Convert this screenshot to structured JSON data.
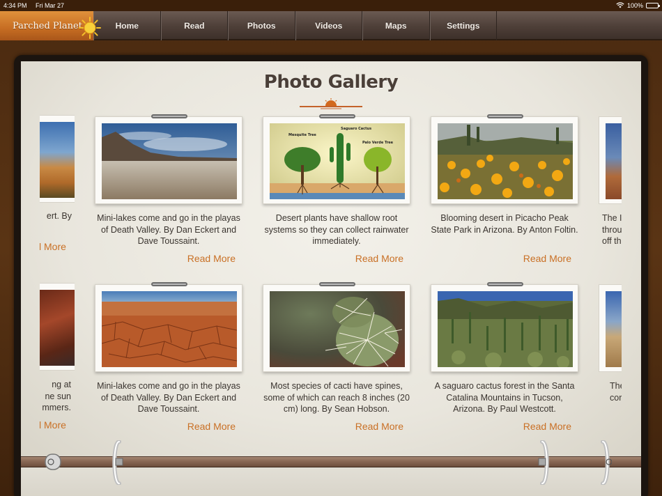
{
  "status": {
    "time": "4:34 PM",
    "date": "Fri Mar 27",
    "battery": "100%"
  },
  "nav": {
    "brand": "Parched Planet",
    "tabs": [
      "Home",
      "Read",
      "Photos",
      "Videos",
      "Maps",
      "Settings"
    ]
  },
  "gallery": {
    "title": "Photo Gallery",
    "read_more": "Read More",
    "row1": [
      {
        "caption": "Mini-lakes come and go in the playas of Death Valley. By Dan Eckert and Dave Toussaint.",
        "photo": "playa-lake"
      },
      {
        "caption": "Desert plants have shallow root systems so they can collect rainwater immediately.",
        "photo": "plant-roots-diagram",
        "labels": {
          "mesquite": "Mesquite Tree",
          "saguaro": "Saguaro Cactus",
          "paloverde": "Palo Verde Tree"
        }
      },
      {
        "caption": "Blooming desert in Picacho Peak State Park in Arizona. By Anton Foltin.",
        "photo": "blooming-desert"
      }
    ],
    "row2": [
      {
        "caption": "Mini-lakes come and go in the playas of Death Valley. By Dan Eckert and Dave Toussaint.",
        "photo": "cracked-earth"
      },
      {
        "caption": "Most species of cacti have spines, some of which can reach 8 inches (20 cm) long. By Sean Hobson.",
        "photo": "cactus-spines"
      },
      {
        "caption": "A saguaro cactus forest in the Santa Catalina Mountains in Tucson, Arizona. By Paul Westcott.",
        "photo": "saguaro-forest"
      }
    ],
    "left_partial": {
      "row1_text": "ert. By",
      "row1_more": "l More",
      "row2_lines": [
        "ng at",
        "ne sun",
        "mmers."
      ],
      "row2_more": "l More"
    },
    "right_partial": {
      "row1_lines": [
        "The I",
        "throu",
        "off th"
      ],
      "row2_lines": [
        "The",
        "cor"
      ]
    }
  },
  "colors": {
    "accent": "#c97025",
    "brand": "#d07f2e",
    "nav": "#4e3f38"
  }
}
